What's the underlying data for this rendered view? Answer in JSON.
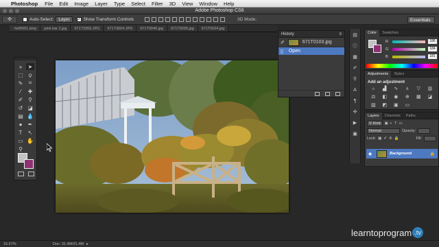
{
  "menubar": {
    "app_name": "Photoshop",
    "items": [
      "File",
      "Edit",
      "Image",
      "Layer",
      "Type",
      "Select",
      "Filter",
      "3D",
      "View",
      "Window",
      "Help"
    ]
  },
  "titlebar": {
    "title": "Adobe Photoshop CS6"
  },
  "options": {
    "auto_select_label": "Auto-Select:",
    "auto_select_value": "Layer",
    "transform_label": "Show Transform Controls",
    "mode_3d_label": "3D Mode:",
    "workspace": "Essentials"
  },
  "tabs": [
    "~lwf0001.bmp",
    "pink bar 2.jpg",
    "671T3369.JPG",
    "671T3604.JPG",
    "671T0040.jpg",
    "671T0035.jpg",
    "671T0024.jpg"
  ],
  "history": {
    "title": "History",
    "snapshot_name": "671T0103.jpg",
    "state_name": "Open"
  },
  "color_panel": {
    "tabs": [
      "Color",
      "Swatches"
    ],
    "r_label": "R",
    "r_value": "186",
    "g_label": "G",
    "g_value": "184",
    "b_label": "B",
    "b_value": "181",
    "foreground": "#c2c2c2",
    "background": "#8e3173"
  },
  "adjustments": {
    "tabs": [
      "Adjustments",
      "Styles"
    ],
    "title": "Add an adjustment"
  },
  "layers": {
    "tabs": [
      "Layers",
      "Channels",
      "Paths"
    ],
    "kind_label": "Kind",
    "blend_mode": "Normal",
    "opacity_label": "Opacity:",
    "lock_label": "Lock:",
    "fill_label": "Fill:",
    "layer_name": "Background"
  },
  "statusbar": {
    "zoom": "16.67%",
    "doc_info": "Doc: 31.4M/31.4M"
  },
  "watermark": {
    "brand": "learntoprogram",
    "tld": ".tv"
  }
}
